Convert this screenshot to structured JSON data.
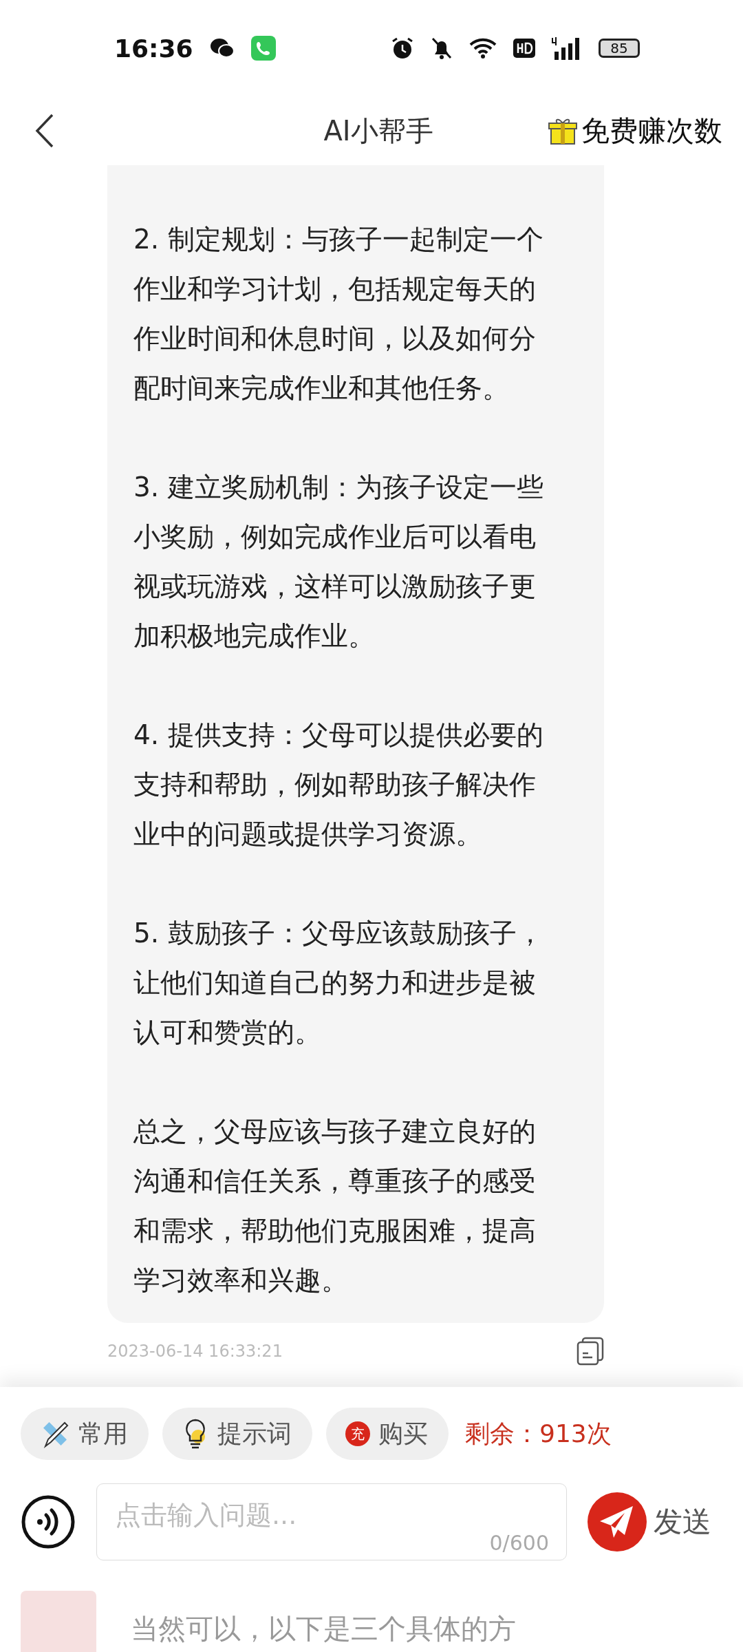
{
  "status_bar": {
    "time": "16:36",
    "battery": "85"
  },
  "header": {
    "title": "AI小帮手",
    "action": "免费赚次数"
  },
  "message": {
    "paragraphs": [
      "2. 制定规划：与孩子一起制定一个作业和学习计划，包括规定每天的作业时间和休息时间，以及如何分配时间来完成作业和其他任务。",
      "3. 建立奖励机制：为孩子设定一些小奖励，例如完成作业后可以看电视或玩游戏，这样可以激励孩子更加积极地完成作业。",
      "4. 提供支持：父母可以提供必要的支持和帮助，例如帮助孩子解决作业中的问题或提供学习资源。",
      "5. 鼓励孩子：父母应该鼓励孩子，让他们知道自己的努力和进步是被认可和赞赏的。",
      "总之，父母应该与孩子建立良好的沟通和信任关系，尊重孩子的感受和需求，帮助他们克服困难，提高学习效率和兴趣。"
    ],
    "timestamp": "2023-06-14 16:33:21"
  },
  "toolbar": {
    "chips": [
      {
        "kind": "common",
        "label": "常用"
      },
      {
        "kind": "prompt",
        "label": "提示词"
      },
      {
        "kind": "buy",
        "label": "购买",
        "badge": "充"
      }
    ],
    "remaining": "剩余：913次"
  },
  "input": {
    "placeholder": "点击输入问题...",
    "counter": "0/600",
    "send": "发送"
  },
  "faded_message": "当然可以，以下是三个具体的方"
}
